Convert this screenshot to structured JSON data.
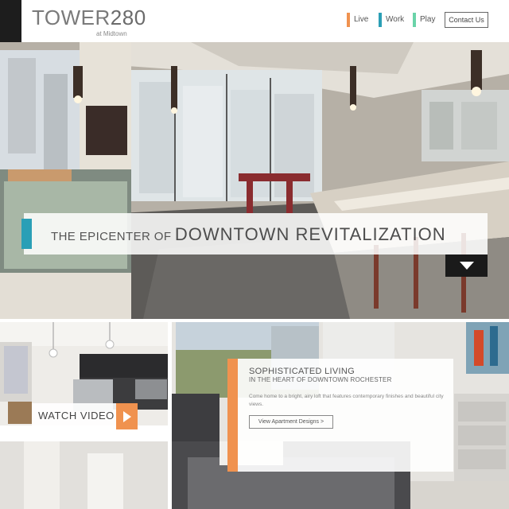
{
  "brand": {
    "name_prefix": "TOWER",
    "name_number": "280",
    "tagline": "at Midtown"
  },
  "nav": {
    "items": [
      {
        "label": "Live",
        "color": "#f0924f"
      },
      {
        "label": "Work",
        "color": "#2b9fb5"
      },
      {
        "label": "Play",
        "color": "#6ad3a9"
      }
    ],
    "contact_label": "Contact Us"
  },
  "hero": {
    "headline_small": "THE EPICENTER OF",
    "headline_large": "DOWNTOWN REVITALIZATION",
    "accent_color": "#2a9fb6",
    "scroll_icon": "chevron-down-icon"
  },
  "video": {
    "label": "WATCH VIDEO",
    "accent_color": "#f0924f",
    "icon": "play-icon"
  },
  "living": {
    "title": "SOPHISTICATED LIVING",
    "subtitle": "IN THE HEART OF DOWNTOWN ROCHESTER",
    "body": "Come home to a bright, airy loft that features contemporary finishes and beautiful city views.",
    "button_label": "View Apartment Designs >",
    "accent_color": "#f0924f"
  }
}
